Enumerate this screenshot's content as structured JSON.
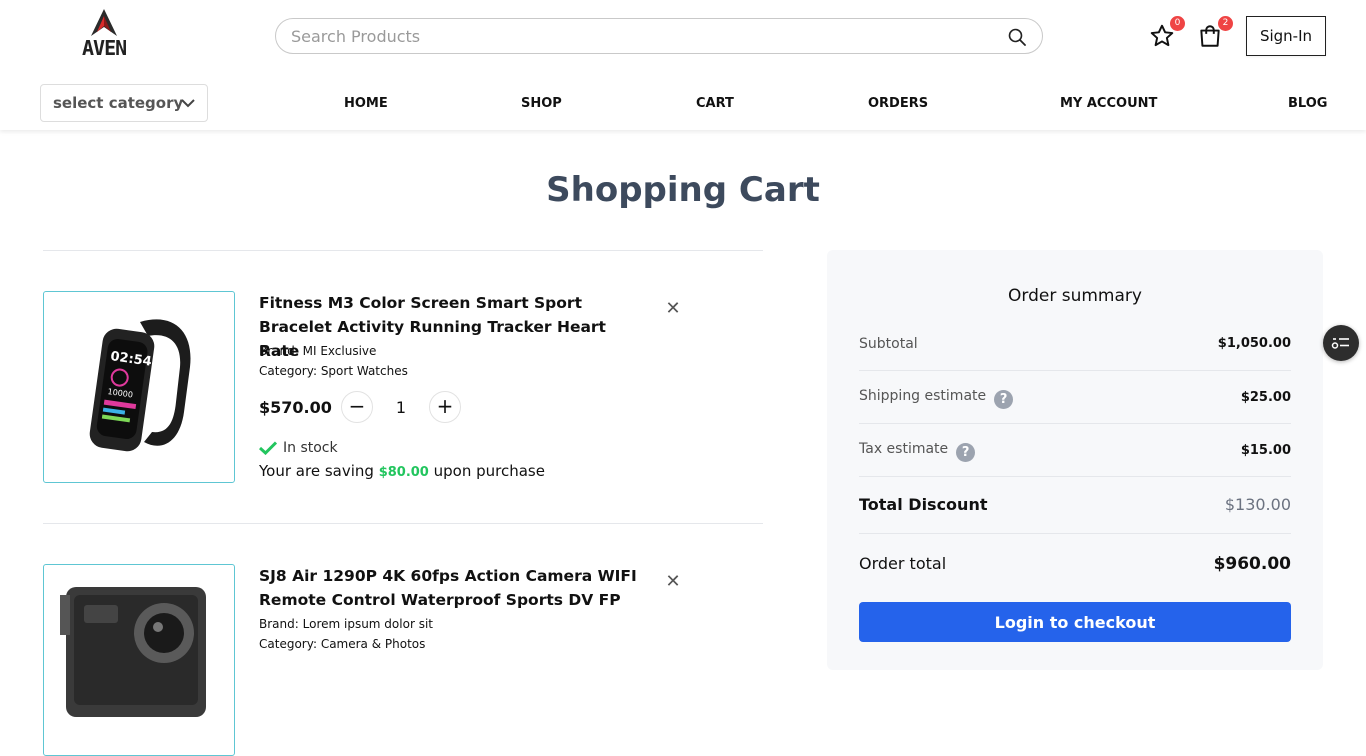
{
  "header": {
    "logo_text": "AVEN",
    "search_placeholder": "Search Products",
    "wishlist_count": "0",
    "cart_count": "2",
    "signin_label": "Sign-In",
    "category_label": "select category",
    "nav": [
      "HOME",
      "SHOP",
      "CART",
      "ORDERS",
      "MY ACCOUNT",
      "BLOG"
    ]
  },
  "page_title": "Shopping Cart",
  "cart_items": [
    {
      "name": "Fitness M3 Color Screen Smart Sport Bracelet Activity Running Tracker Heart Rate",
      "brand_label": "Brand:",
      "brand": "MI Exclusive",
      "category_label": "Category:",
      "category": "Sport Watches",
      "price": "$570.00",
      "quantity": "1",
      "stock": "In stock",
      "saving_prefix": "Your are saving",
      "saving_amount": "$80.00",
      "saving_suffix": "upon purchase"
    },
    {
      "name": "SJ8 Air 1290P 4K 60fps Action Camera WIFI Remote Control Waterproof Sports DV FP",
      "brand_label": "Brand:",
      "brand": "Lorem ipsum dolor sit",
      "category_label": "Category:",
      "category": "Camera & Photos"
    }
  ],
  "summary": {
    "title": "Order summary",
    "subtotal_label": "Subtotal",
    "subtotal": "$1,050.00",
    "shipping_label": "Shipping estimate",
    "shipping": "$25.00",
    "tax_label": "Tax estimate",
    "tax": "$15.00",
    "discount_label": "Total Discount",
    "discount": "$130.00",
    "total_label": "Order total",
    "total": "$960.00",
    "checkout_label": "Login to checkout"
  },
  "colors": {
    "accent": "#2563eb",
    "badge": "#ef4444",
    "saving": "#22c55e",
    "title": "#3d4a5d"
  }
}
